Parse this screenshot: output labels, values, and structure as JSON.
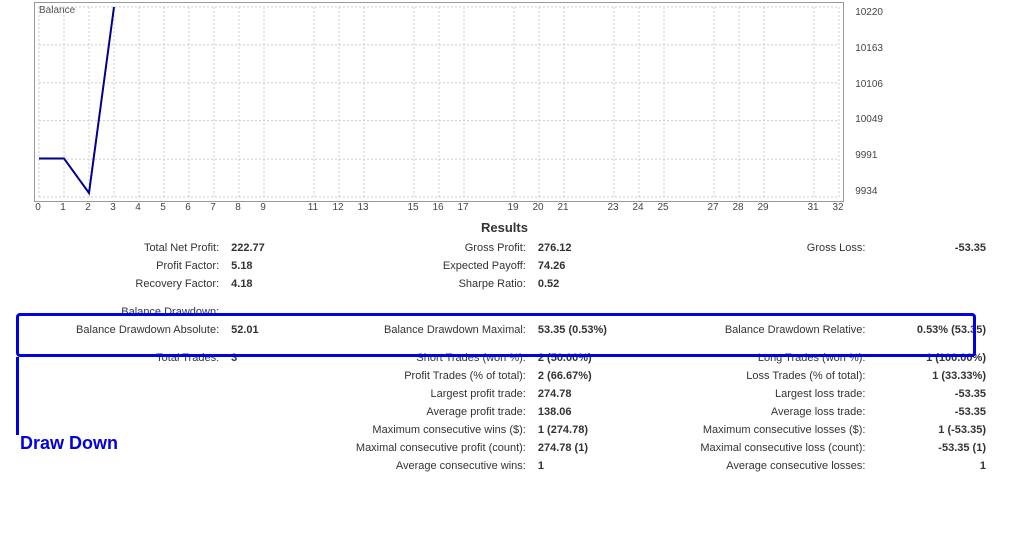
{
  "chart_data": {
    "type": "line",
    "title": "Balance",
    "x": [
      0,
      1,
      2,
      3
    ],
    "values": [
      9992,
      9992,
      9940,
      10220
    ],
    "xlim": [
      0,
      32
    ],
    "ylim": [
      9934,
      10220
    ],
    "x_ticks": [
      0,
      1,
      2,
      3,
      4,
      5,
      6,
      7,
      8,
      9,
      11,
      12,
      13,
      15,
      16,
      17,
      19,
      20,
      21,
      23,
      24,
      25,
      27,
      28,
      29,
      31,
      32
    ],
    "y_ticks": [
      10220,
      10163,
      10106,
      10049,
      9991,
      9934
    ]
  },
  "header": {
    "results": "Results"
  },
  "r1": {
    "l1": "Total Net Profit:",
    "v1": "222.77",
    "l2": "Gross Profit:",
    "v2": "276.12",
    "l3": "Gross Loss:",
    "v3": "-53.35"
  },
  "r2": {
    "l1": "Profit Factor:",
    "v1": "5.18",
    "l2": "Expected Payoff:",
    "v2": "74.26"
  },
  "r3": {
    "l1": "Recovery Factor:",
    "v1": "4.18",
    "l2": "Sharpe Ratio:",
    "v2": "0.52"
  },
  "dd_header": "Balance Drawdown:",
  "dd": {
    "l1": "Balance Drawdown Absolute:",
    "v1": "52.01",
    "l2": "Balance Drawdown Maximal:",
    "v2": "53.35 (0.53%)",
    "l3": "Balance Drawdown Relative:",
    "v3": "0.53% (53.35)"
  },
  "t1": {
    "l1": "Total Trades:",
    "v1": "3",
    "l2": "Short Trades (won %):",
    "v2": "2 (50.00%)",
    "l3": "Long Trades (won %):",
    "v3": "1 (100.00%)"
  },
  "t2": {
    "l2": "Profit Trades (% of total):",
    "v2": "2 (66.67%)",
    "l3": "Loss Trades (% of total):",
    "v3": "1 (33.33%)"
  },
  "t3": {
    "l2": "Largest profit trade:",
    "v2": "274.78",
    "l3": "Largest loss trade:",
    "v3": "-53.35"
  },
  "t4": {
    "l2": "Average profit trade:",
    "v2": "138.06",
    "l3": "Average loss trade:",
    "v3": "-53.35"
  },
  "t5": {
    "l2": "Maximum consecutive wins ($):",
    "v2": "1 (274.78)",
    "l3": "Maximum consecutive losses ($):",
    "v3": "1 (-53.35)"
  },
  "t6": {
    "l2": "Maximal consecutive profit (count):",
    "v2": "274.78 (1)",
    "l3": "Maximal consecutive loss (count):",
    "v3": "-53.35 (1)"
  },
  "t7": {
    "l2": "Average consecutive wins:",
    "v2": "1",
    "l3": "Average consecutive losses:",
    "v3": "1"
  },
  "annotation": "Draw Down"
}
